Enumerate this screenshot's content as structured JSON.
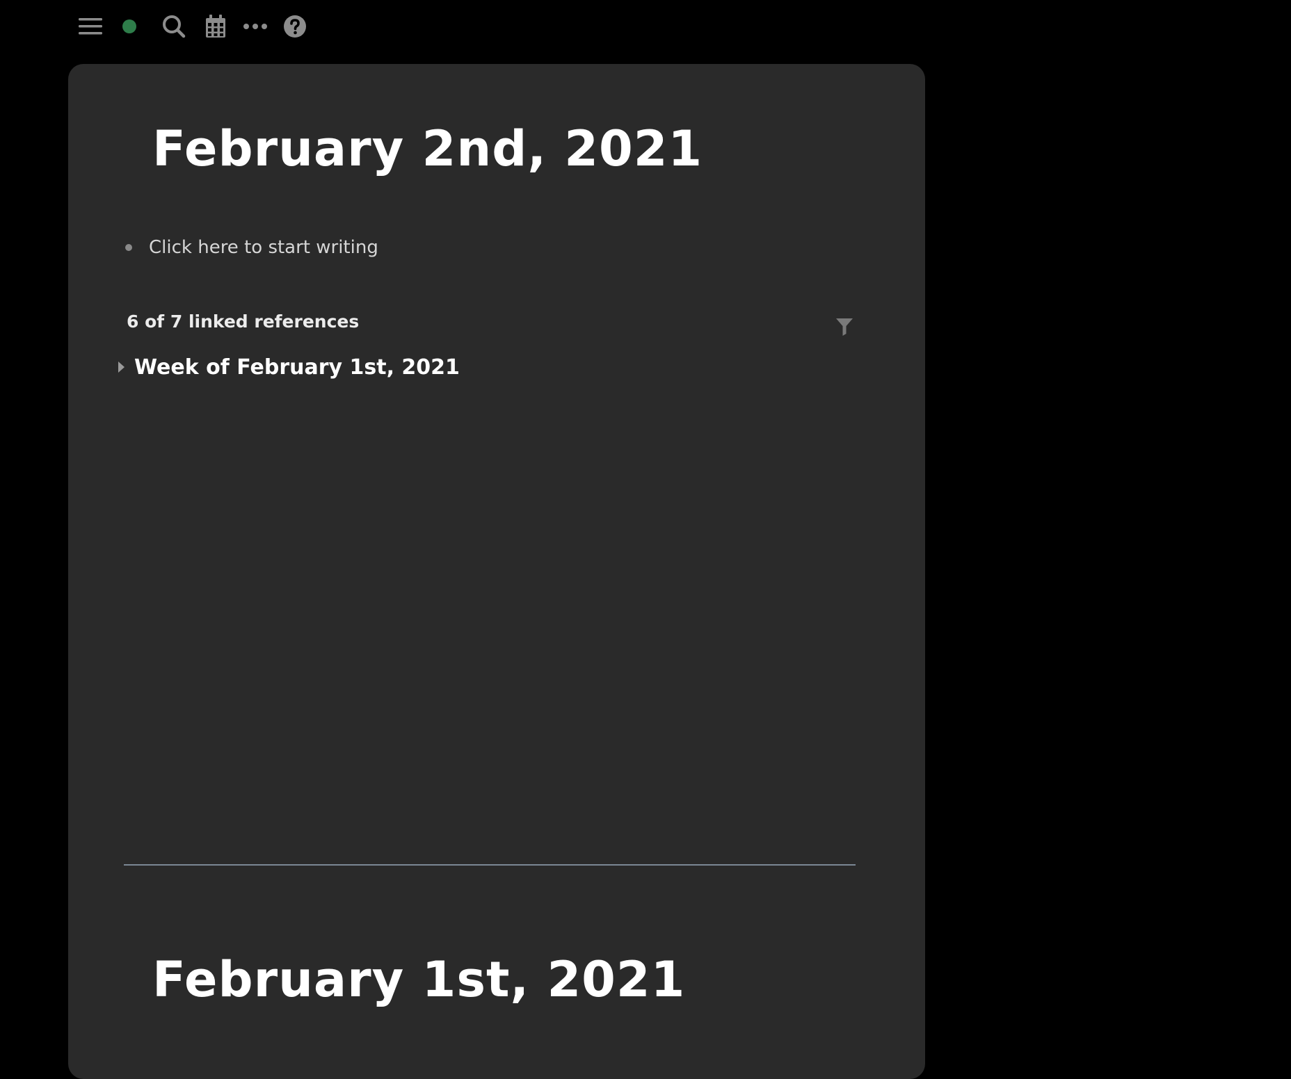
{
  "toolbar": {
    "icons": [
      "hamburger-menu-icon",
      "sync-status-icon",
      "search-icon",
      "calendar-icon",
      "more-icon",
      "help-icon"
    ],
    "sync_color": "#2e7d4a"
  },
  "pages": [
    {
      "title": "February 2nd, 2021",
      "placeholder": "Click here to start writing",
      "references": {
        "header": "6 of 7 linked references",
        "groups": [
          {
            "title": "Week of February 1st, 2021"
          }
        ]
      }
    },
    {
      "title": "February 1st, 2021"
    }
  ],
  "colors": {
    "background": "#000000",
    "panel": "#2a2a2a",
    "divider": "#7b8794",
    "accent_green": "#2e7d4a"
  }
}
